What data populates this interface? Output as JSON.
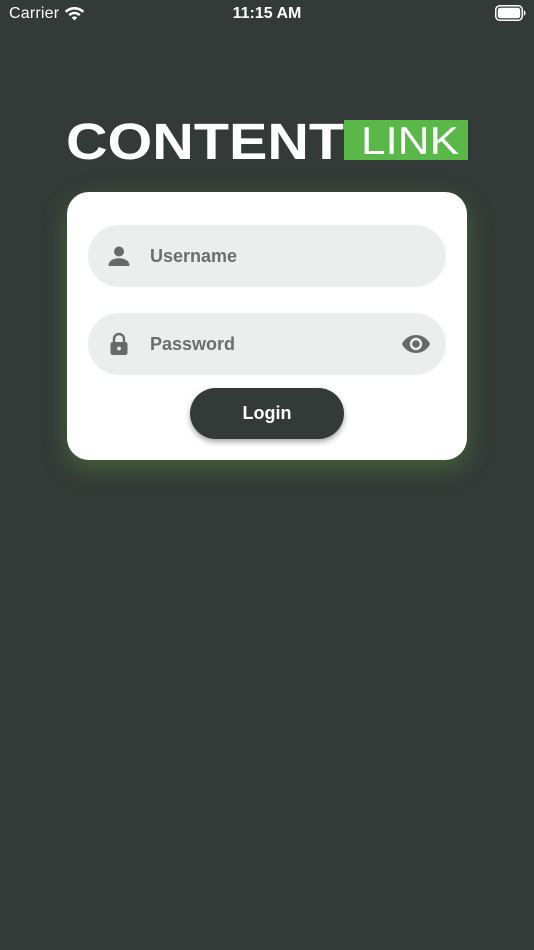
{
  "status_bar": {
    "carrier": "Carrier",
    "time": "11:15 AM",
    "wifi_icon": "wifi-icon",
    "battery_icon": "battery-icon"
  },
  "logo": {
    "word_primary": "CONTENT",
    "word_secondary": "LINK",
    "accent_color": "#5ab848"
  },
  "login_form": {
    "username": {
      "placeholder": "Username",
      "value": "",
      "icon": "user-icon"
    },
    "password": {
      "placeholder": "Password",
      "value": "",
      "icon": "lock-icon",
      "toggle_icon": "eye-icon"
    },
    "submit_label": "Login"
  },
  "colors": {
    "background": "#333a38",
    "card": "#ffffff",
    "field": "#eceeed",
    "button": "#333a38",
    "accent": "#5ab848"
  }
}
